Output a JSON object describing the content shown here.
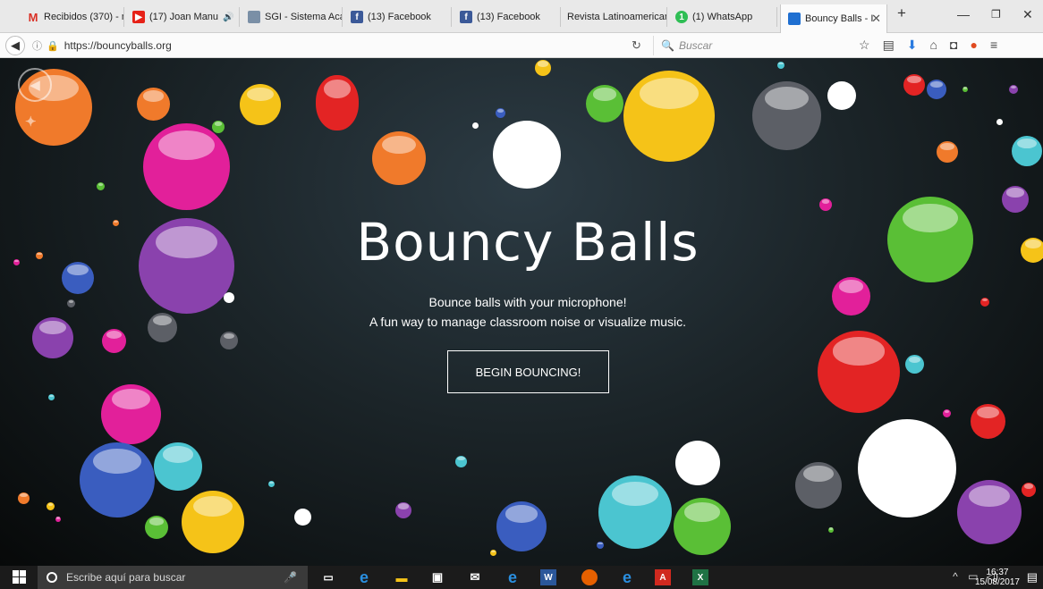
{
  "tabs": [
    {
      "label": "Recibidos (370) - m",
      "icon": "gmail-icon",
      "color": "#d93025"
    },
    {
      "label": "(17) Joan Manu",
      "icon": "youtube-icon",
      "color": "#e62117"
    },
    {
      "label": "SGI - Sistema Acad",
      "icon": "sgi-icon",
      "color": "#7a8fa6"
    },
    {
      "label": "(13) Facebook",
      "icon": "facebook-icon",
      "color": "#3b5998"
    },
    {
      "label": "(13) Facebook",
      "icon": "facebook-icon",
      "color": "#3b5998"
    },
    {
      "label": "Revista Latinoamerican",
      "icon": "",
      "color": "#999999"
    },
    {
      "label": "(1) WhatsApp",
      "icon": "whatsapp-icon",
      "color": "#2fbe55"
    },
    {
      "label": "Bouncy Balls - I",
      "icon": "bouncyballs-icon",
      "color": "#1f6fd1"
    }
  ],
  "nav": {
    "url": "https://bouncyballs.org",
    "search_placeholder": "Buscar"
  },
  "page": {
    "title": "Bouncy Balls",
    "subtitle_line1": "Bounce balls with your microphone!",
    "subtitle_line2": "A fun way to manage classroom noise or visualize music.",
    "cta_label": "BEGIN BOUNCING!"
  },
  "taskbar": {
    "search_placeholder": "Escribe aquí para buscar",
    "time": "16:37",
    "date": "15/08/2017"
  }
}
